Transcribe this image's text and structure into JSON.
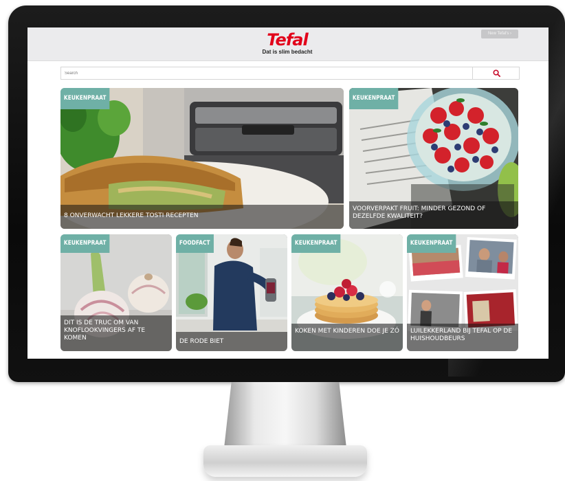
{
  "header": {
    "logo_text": "Tefal",
    "logo_tagline": "Dat is slim bedacht",
    "newsletter_label": "New Tefal's ›",
    "brand_color": "#e2001a"
  },
  "search": {
    "placeholder": "Search",
    "icon": "search-icon"
  },
  "cards": [
    {
      "tag": "KEUKENPRAAT",
      "title": "8 ONVERWACHT LEKKERE TOSTI RECEPTEN"
    },
    {
      "tag": "KEUKENPRAAT",
      "title": "VOORVERPAKT FRUIT: MINDER GEZOND OF DEZELFDE KWALITEIT?"
    },
    {
      "tag": "KEUKENPRAAT",
      "title": "DIT IS DE TRUC OM VAN KNOFLOOKVINGERS AF TE KOMEN"
    },
    {
      "tag": "FOODFACT",
      "title": "DE RODE BIET"
    },
    {
      "tag": "KEUKENPRAAT",
      "title": "KOKEN MET KINDEREN DOE JE ZÓ"
    },
    {
      "tag": "KEUKENPRAAT",
      "title": "LUILEKKERLAND BIJ TEFAL OP DE HUISHOUDBEURS"
    }
  ],
  "colors": {
    "tag_background": "#6fb0a6",
    "caption_overlay": "rgba(20,20,20,0.55)"
  }
}
